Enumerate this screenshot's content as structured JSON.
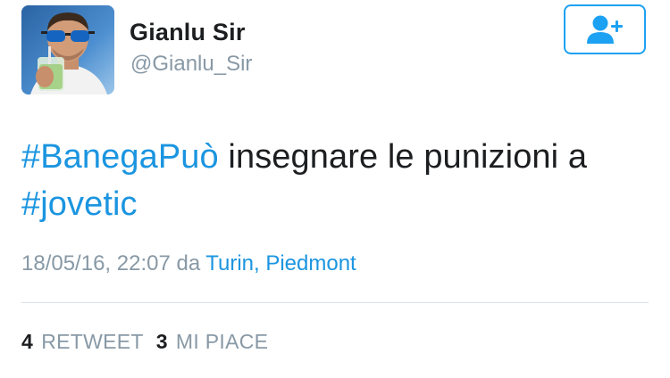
{
  "user": {
    "name": "Gianlu Sir",
    "handle": "@Gianlu_Sir"
  },
  "follow_button": {
    "icon": "follow-user-plus-icon",
    "color": "#1da1f2"
  },
  "tweet": {
    "hashtag_1": "#BanegaPuò",
    "text_middle": " insegnare le punizioni a ",
    "hashtag_2": "#jovetic"
  },
  "meta": {
    "timestamp": "18/05/16, 22:07",
    "via": "da",
    "location": "Turin, Piedmont"
  },
  "stats": {
    "retweet_count": "4",
    "retweet_label": "RETWEET",
    "likes_count": "3",
    "likes_label": "MI PIACE"
  },
  "colors": {
    "link": "#1b95e0",
    "muted": "#8899a6",
    "text": "#1c1e20"
  }
}
